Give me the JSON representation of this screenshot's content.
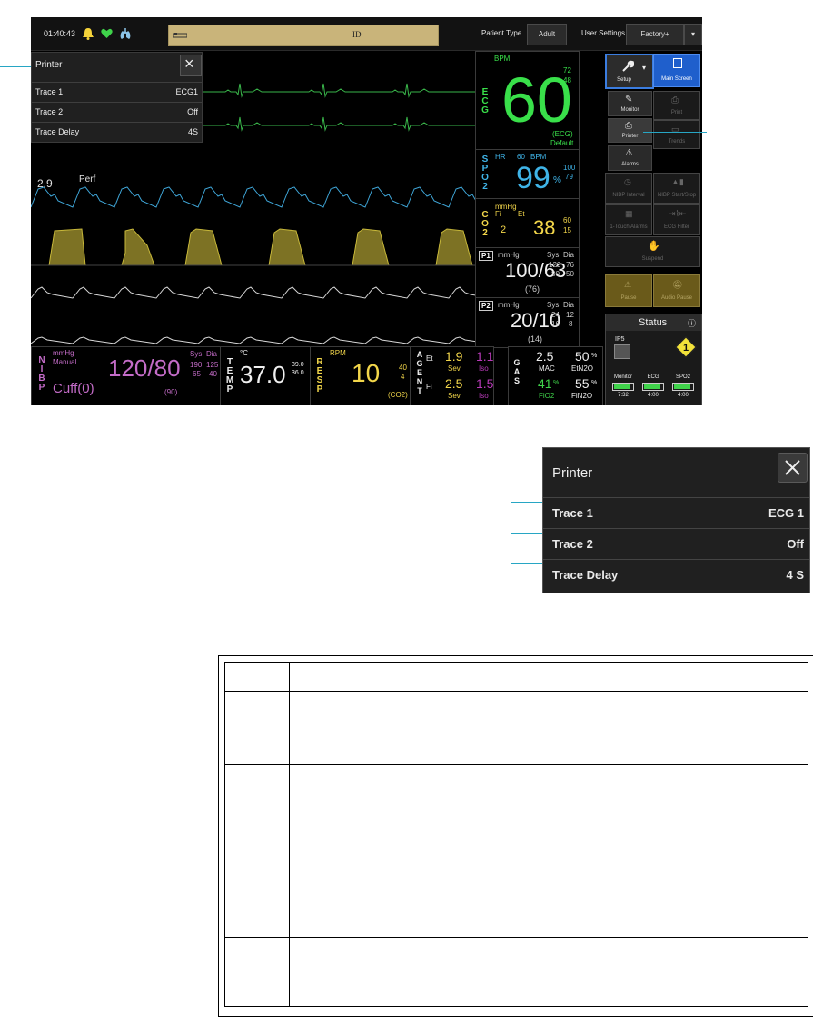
{
  "topbar": {
    "time": "01:40:43",
    "id_label": "ID",
    "patient_type_label": "Patient Type",
    "patient_type_value": "Adult",
    "user_settings_label": "User Settings",
    "user_settings_value": "Factory+"
  },
  "printer_popup": {
    "title": "Printer",
    "rows": [
      {
        "label": "Trace 1",
        "value": "ECG1"
      },
      {
        "label": "Trace 2",
        "value": "Off"
      },
      {
        "label": "Trace Delay",
        "value": "4S"
      }
    ]
  },
  "waves": {
    "spo2_value_label": "2.9",
    "perf_label": "Perf"
  },
  "ecg": {
    "name": "ECG",
    "unit": "BPM",
    "value": "60",
    "upper": "72",
    "lower": "48",
    "source": "(ECG)",
    "setting": "Default",
    "color": "#39e04a"
  },
  "spo2": {
    "name": "SPO2",
    "hr_label": "HR",
    "hr_value": "60",
    "hr_unit": "BPM",
    "value": "99",
    "unit": "%",
    "upper": "100",
    "lower": "79",
    "color": "#3fb4e8"
  },
  "co2": {
    "name": "CO2",
    "unit": "mmHg",
    "fi_label": "Fi",
    "fi_value": "2",
    "et_label": "Et",
    "et_value": "38",
    "upper": "60",
    "lower": "15",
    "color": "#f2d64a"
  },
  "p1": {
    "name": "P1",
    "unit": "mmHg",
    "value": "100/63",
    "mean": "(76)",
    "sys_label": "Sys",
    "dia_label": "Dia",
    "sys_hi": "120",
    "dia_hi": "76",
    "sys_lo": "80",
    "dia_lo": "50"
  },
  "p2": {
    "name": "P2",
    "unit": "mmHg",
    "value": "20/10",
    "mean": "(14)",
    "sys_label": "Sys",
    "dia_label": "Dia",
    "sys_hi": "24",
    "dia_hi": "12",
    "sys_lo": "16",
    "dia_lo": "8"
  },
  "nibp": {
    "name": "NIBP",
    "unit": "mmHg",
    "mode": "Manual",
    "value": "120/80",
    "cuff": "Cuff(0)",
    "mean": "(90)",
    "sys_label": "Sys",
    "dia_label": "Dia",
    "sys_hi": "190",
    "dia_hi": "125",
    "sys_lo": "65",
    "dia_lo": "40",
    "color": "#c46cc8"
  },
  "temp": {
    "name": "TEMP",
    "unit": "°C",
    "value": "37.0",
    "upper": "39.0",
    "lower": "36.0"
  },
  "resp": {
    "name": "RESP",
    "unit": "RPM",
    "value": "10",
    "upper": "40",
    "lower": "4",
    "source": "(CO2)"
  },
  "agent": {
    "name": "AGENT",
    "et_label": "Et",
    "fi_label": "Fi",
    "et_sev": "1.9",
    "et_iso": "1.1",
    "fi_sev": "2.5",
    "fi_iso": "1.5",
    "sev_label": "Sev",
    "iso_label": "Iso"
  },
  "gas": {
    "name": "GAS",
    "mac_value": "2.5",
    "mac_label": "MAC",
    "etn2o_value": "50",
    "etn2o_label": "EtN2O",
    "fio2_value": "41",
    "fio2_label": "FiO2",
    "fin2o_value": "55",
    "fin2o_label": "FiN2O",
    "pct": "%"
  },
  "right_panel": {
    "setup_label": "Setup",
    "main_screen_label": "Main Screen",
    "monitor_label": "Monitor",
    "print_label": "Print",
    "printer_label": "Printer",
    "trends_label": "Trends",
    "alarms_label": "Alarms",
    "nibp_interval_label": "NIBP Interval",
    "nibp_start_label": "NIBP Start/Stop",
    "one_touch_label": "1-Touch Alarms",
    "ecg_filter_label": "ECG Filter",
    "suspend_label": "Suspend",
    "pause_label": "Pause",
    "audio_pause_label": "Audio Pause",
    "status_title": "Status",
    "ip5_label": "IP5",
    "alert_number": "1",
    "batteries": [
      {
        "label": "Monitor",
        "time": "7:32"
      },
      {
        "label": "ECG",
        "time": "4:00"
      },
      {
        "label": "SPO2",
        "time": "4:00"
      }
    ]
  },
  "zoom_popup": {
    "title": "Printer",
    "rows": [
      {
        "label": "Trace 1",
        "value": "ECG 1"
      },
      {
        "label": "Trace 2",
        "value": "Off"
      },
      {
        "label": "Trace Delay",
        "value": "4 S"
      }
    ]
  },
  "colors": {
    "callout": "#27a6c4",
    "nibp": "#c46cc8",
    "co2_fill": "#7d7224"
  }
}
